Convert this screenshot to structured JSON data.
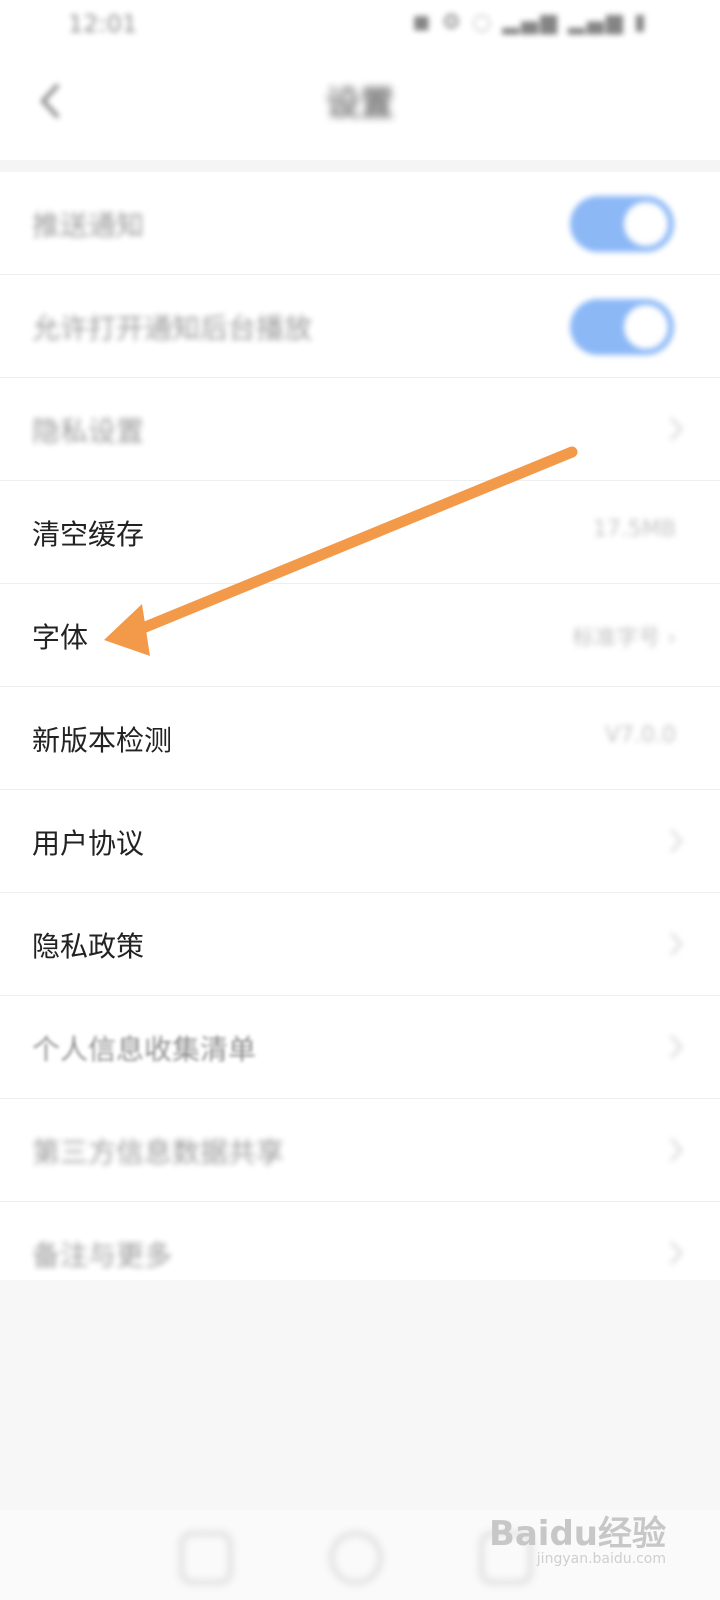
{
  "statusbar": {
    "time": "12:01",
    "icons": "◼ ⚙ ◌ ▂▄▆ ▂▄▆ ▮"
  },
  "header": {
    "title": "设置",
    "back_icon": "chevron-left-icon"
  },
  "settings": {
    "row1_label": "推送通知",
    "row2_label": "允许打开通知后台播放",
    "row3_label": "隐私设置",
    "row4_label": "清空缓存",
    "row4_value": "17.5MB",
    "row5_label": "字体",
    "row5_value": "标准字号 ›",
    "row6_label": "新版本检测",
    "row6_value": "V7.0.0",
    "row7_label": "用户协议",
    "row8_label": "隐私政策",
    "row9_label": "个人信息收集清单",
    "row10_label": "第三方信息数据共享",
    "row11_label": "备注与更多"
  },
  "annotation": {
    "arrow_color": "#f39a4a"
  },
  "watermark": {
    "brand": "Baidu经验",
    "url": "jingyan.baidu.com"
  },
  "colors": {
    "toggle_on": "#2f7ff0",
    "gray_area": "#f7f7f7"
  }
}
